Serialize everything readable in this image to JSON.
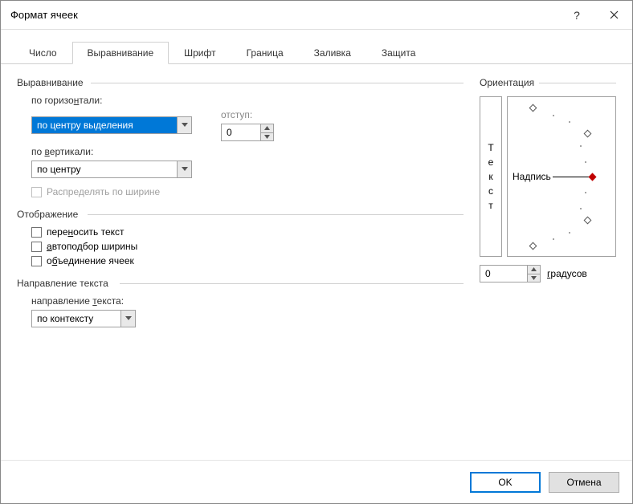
{
  "window": {
    "title": "Формат ячеек"
  },
  "tabs": {
    "number": "Число",
    "alignment": "Выравнивание",
    "font": "Шрифт",
    "border": "Граница",
    "fill": "Заливка",
    "protection": "Защита"
  },
  "alignment": {
    "group_label": "Выравнивание",
    "horizontal_label": "по горизонтали:",
    "horizontal_underline": "н",
    "horizontal_value": "по центру выделения",
    "vertical_label": "по вертикали:",
    "vertical_underline": "в",
    "vertical_value": "по центру",
    "indent_label": "отступ:",
    "indent_value": "0",
    "distribute_label": "Распределять по ширине"
  },
  "display": {
    "group_label": "Отображение",
    "wrap_text": "переносить текст",
    "shrink_fit": "автоподбор ширины",
    "merge_cells": "объединение ячеек"
  },
  "text_direction": {
    "group_label": "Направление текста",
    "field_label": "направление текста:",
    "field_underline": "т",
    "value": "по контексту"
  },
  "orientation": {
    "group_label": "Ориентация",
    "vertical_text": [
      "Т",
      "е",
      "к",
      "с",
      "т"
    ],
    "dial_label": "Надпись",
    "degrees_value": "0",
    "degrees_label": "градусов",
    "degrees_underline": "г"
  },
  "footer": {
    "ok": "OK",
    "cancel": "Отмена"
  }
}
